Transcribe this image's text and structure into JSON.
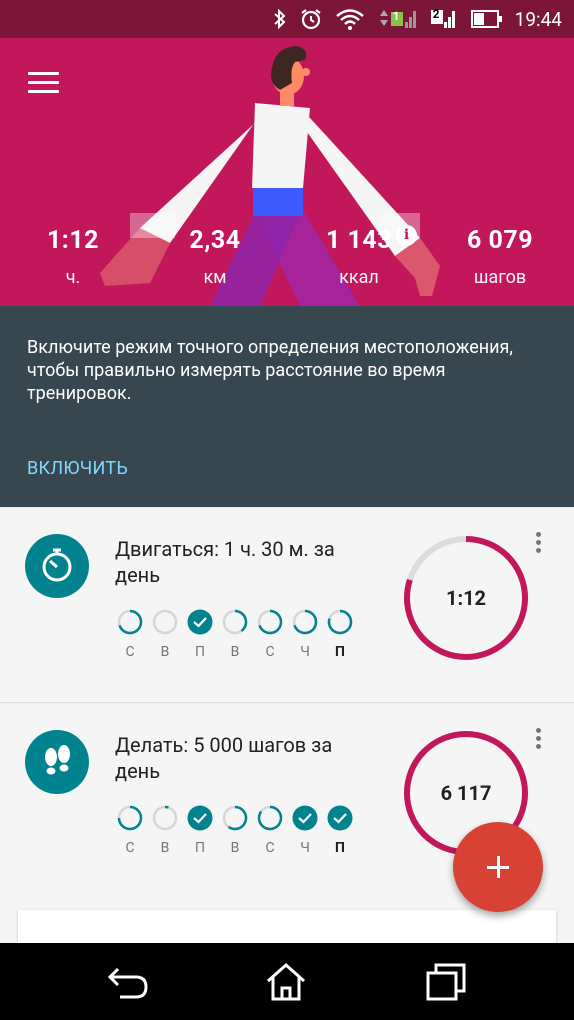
{
  "status_bar": {
    "time": "19:44",
    "sim1_badge": "1",
    "sim2_badge": "2",
    "icons": [
      "bluetooth-icon",
      "alarm-icon",
      "wifi-icon",
      "signal-icon",
      "battery-icon"
    ]
  },
  "header": {
    "background_color": "#c2185b",
    "stats": [
      {
        "value": "1:12",
        "unit": "ч."
      },
      {
        "value": "2,34",
        "unit": "км"
      },
      {
        "value": "1 143",
        "unit": "ккал"
      },
      {
        "value": "6 079",
        "unit": "шагов"
      }
    ],
    "info_icon": "i"
  },
  "banner": {
    "message": "Включите режим точного определения местоположения, чтобы правильно измерять расстояние во время тренировок.",
    "action_label": "ВКЛЮЧИТЬ"
  },
  "goals": [
    {
      "title": "Двигаться: 1 ч. 30 м. за день",
      "icon": "timer-icon",
      "ring_value": "1:12",
      "ring_progress": 0.8,
      "days": [
        {
          "label": "С",
          "progress": 0.7,
          "done": false
        },
        {
          "label": "В",
          "progress": 0.0,
          "done": false
        },
        {
          "label": "П",
          "progress": 1.0,
          "done": true
        },
        {
          "label": "В",
          "progress": 0.4,
          "done": false
        },
        {
          "label": "С",
          "progress": 0.7,
          "done": false
        },
        {
          "label": "Ч",
          "progress": 0.7,
          "done": false
        },
        {
          "label": "П",
          "progress": 0.8,
          "done": false,
          "today": true
        }
      ]
    },
    {
      "title": "Делать: 5 000 шагов за день",
      "icon": "footsteps-icon",
      "ring_value": "6 117",
      "ring_progress": 1.0,
      "days": [
        {
          "label": "С",
          "progress": 0.75,
          "done": false
        },
        {
          "label": "В",
          "progress": 0.05,
          "done": false
        },
        {
          "label": "П",
          "progress": 1.0,
          "done": true
        },
        {
          "label": "В",
          "progress": 0.6,
          "done": false
        },
        {
          "label": "С",
          "progress": 0.85,
          "done": false
        },
        {
          "label": "Ч",
          "progress": 1.0,
          "done": true
        },
        {
          "label": "П",
          "progress": 1.0,
          "done": true,
          "today": true
        }
      ]
    }
  ],
  "colors": {
    "accent": "#c2185b",
    "teal": "#00838f",
    "banner": "#37474f",
    "link": "#80d8ff",
    "fab": "#d84234"
  }
}
